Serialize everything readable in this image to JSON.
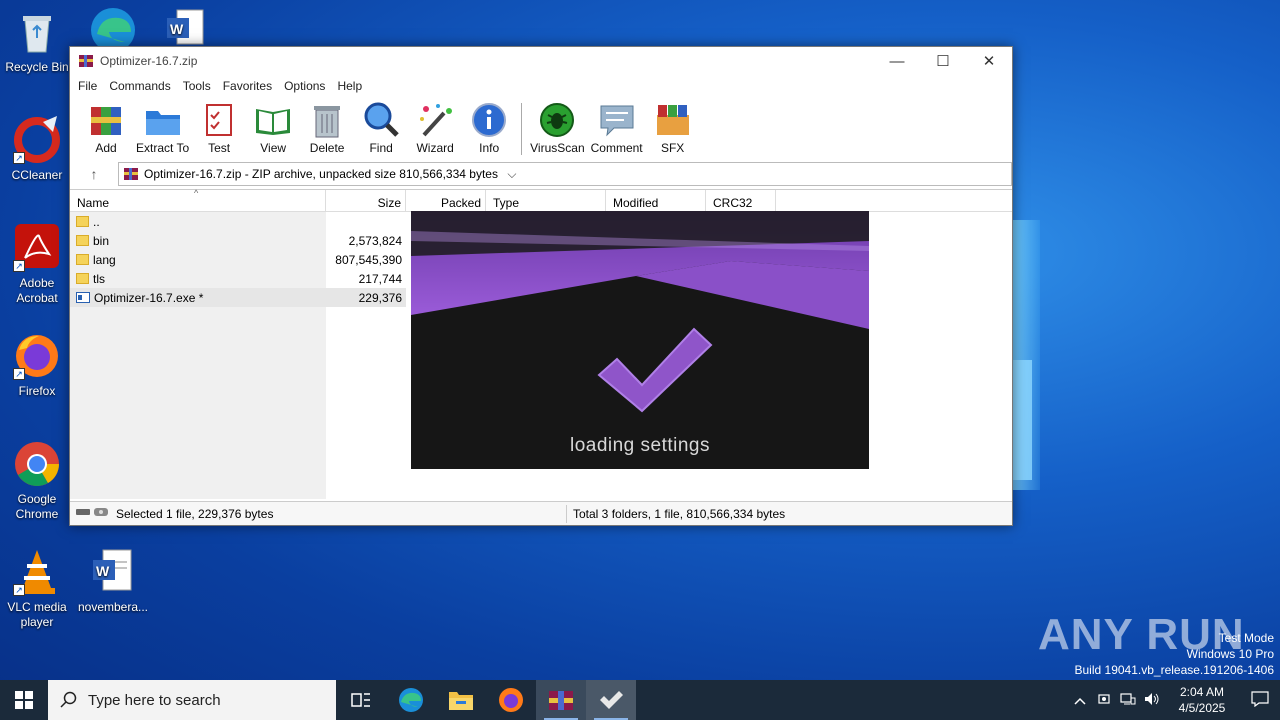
{
  "desktop": {
    "icons": [
      {
        "label": "Recycle Bin"
      },
      {
        "label": "CCleaner"
      },
      {
        "label": "Adobe Acrobat"
      },
      {
        "label": "Firefox"
      },
      {
        "label": "Google Chrome"
      },
      {
        "label": "VLC media player"
      },
      {
        "label": "novembera..."
      }
    ],
    "link_glyph": "↗"
  },
  "window": {
    "title": "Optimizer-16.7.zip",
    "controls": {
      "minimize": "—",
      "maximize": "☐",
      "close": "✕"
    },
    "menu": [
      "File",
      "Commands",
      "Tools",
      "Favorites",
      "Options",
      "Help"
    ],
    "toolbar": [
      "Add",
      "Extract To",
      "Test",
      "View",
      "Delete",
      "Find",
      "Wizard",
      "Info",
      "VirusScan",
      "Comment",
      "SFX"
    ],
    "address": {
      "up": "↑",
      "text": "Optimizer-16.7.zip - ZIP archive, unpacked size 810,566,334 bytes",
      "dropdown": "⌵"
    },
    "columns": {
      "name": "Name",
      "size": "Size",
      "packed": "Packed",
      "type": "Type",
      "modified": "Modified",
      "crc": "CRC32"
    },
    "files": [
      {
        "name": "..",
        "size": "",
        "kind": "folder"
      },
      {
        "name": "bin",
        "size": "2,573,824",
        "kind": "folder"
      },
      {
        "name": "lang",
        "size": "807,545,390",
        "kind": "folder"
      },
      {
        "name": "tls",
        "size": "217,744",
        "kind": "folder"
      },
      {
        "name": "Optimizer-16.7.exe *",
        "size": "229,376",
        "kind": "exe"
      }
    ],
    "status": {
      "selected": "Selected 1 file, 229,376 bytes",
      "total": "Total 3 folders, 1 file, 810,566,334 bytes"
    }
  },
  "splash": {
    "text": "loading settings",
    "accent": "#8f55c9"
  },
  "taskbar": {
    "search_placeholder": "Type here to search",
    "time": "2:04 AM",
    "date": "4/5/2025"
  },
  "watermark": {
    "line1": "Test Mode",
    "line2": "Windows 10 Pro",
    "line3": "Build 19041.vb_release.191206-1406",
    "brand": "ANY RUN"
  }
}
